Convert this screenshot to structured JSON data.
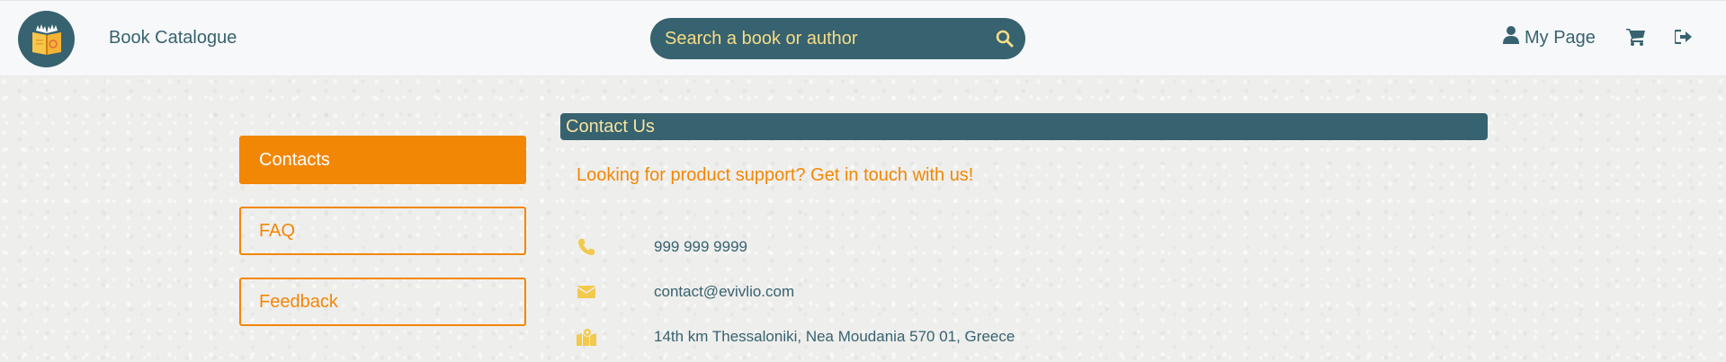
{
  "header": {
    "brand": "Book Catalogue",
    "search": {
      "placeholder": "Search a book or author"
    },
    "my_page_label": "My Page",
    "icons": {
      "logo": "book-logo-icon",
      "search": "search-icon",
      "user": "user-icon",
      "cart": "cart-icon",
      "logout": "logout-icon"
    }
  },
  "sidebar": {
    "items": [
      {
        "label": "Contacts",
        "active": true
      },
      {
        "label": "FAQ",
        "active": false
      },
      {
        "label": "Feedback",
        "active": false
      }
    ]
  },
  "main": {
    "title": "Contact Us",
    "lead": "Looking for product support? Get in touch with us!",
    "contacts": {
      "phone": "999 999 9999",
      "email": "contact@evivlio.com",
      "address": "14th km Thessaloniki, Nea Moudania 570 01, Greece"
    }
  },
  "colors": {
    "primary": "#37626f",
    "accent": "#f28705",
    "icon_yellow": "#f2c94c",
    "title_text": "#f7e3a1"
  }
}
